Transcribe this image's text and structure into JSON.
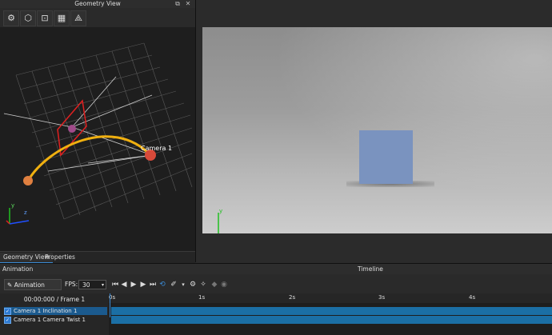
{
  "geometry_panel": {
    "title": "Geometry View",
    "pin_icon": "pin-icon",
    "close_icon": "close-icon",
    "toolbar_icons": [
      "gear-icon",
      "cube-icon",
      "zoom-fit-icon",
      "grid-icon",
      "axes-icon"
    ],
    "viewport_label": "Camera 1",
    "tabs": [
      {
        "label": "Geometry View",
        "active": true
      },
      {
        "label": "Properties",
        "active": false
      }
    ]
  },
  "axis_labels": {
    "x": "x",
    "y": "y",
    "z": "z"
  },
  "colors": {
    "accent": "#3a8bd6",
    "track_bar": "#1b6fa5",
    "camera_frame": "#e02020",
    "path": "#f0b010",
    "cube": "#7a93bf"
  },
  "animation_panel": {
    "title": "Animation",
    "timeline_title": "Timeline",
    "wizard_label": "Animation Wizard",
    "fps_label": "FPS:",
    "fps_value": "30",
    "frame_label": "00:00:000 / Frame 1",
    "playback_icons": [
      "skip-start-icon",
      "step-back-icon",
      "play-icon",
      "step-forward-icon",
      "skip-end-icon",
      "loop-icon",
      "brush-icon",
      "chevron-down-icon",
      "settings-icon",
      "keyframe-icon",
      "prev-key-icon",
      "record-icon"
    ],
    "time_ticks": [
      "0s",
      "1s",
      "2s",
      "3s",
      "4s"
    ],
    "tracks": [
      {
        "label": "Camera 1 Inclination 1",
        "checked": true,
        "selected": true
      },
      {
        "label": "Camera 1 Camera Twist 1",
        "checked": true,
        "selected": false
      }
    ]
  }
}
